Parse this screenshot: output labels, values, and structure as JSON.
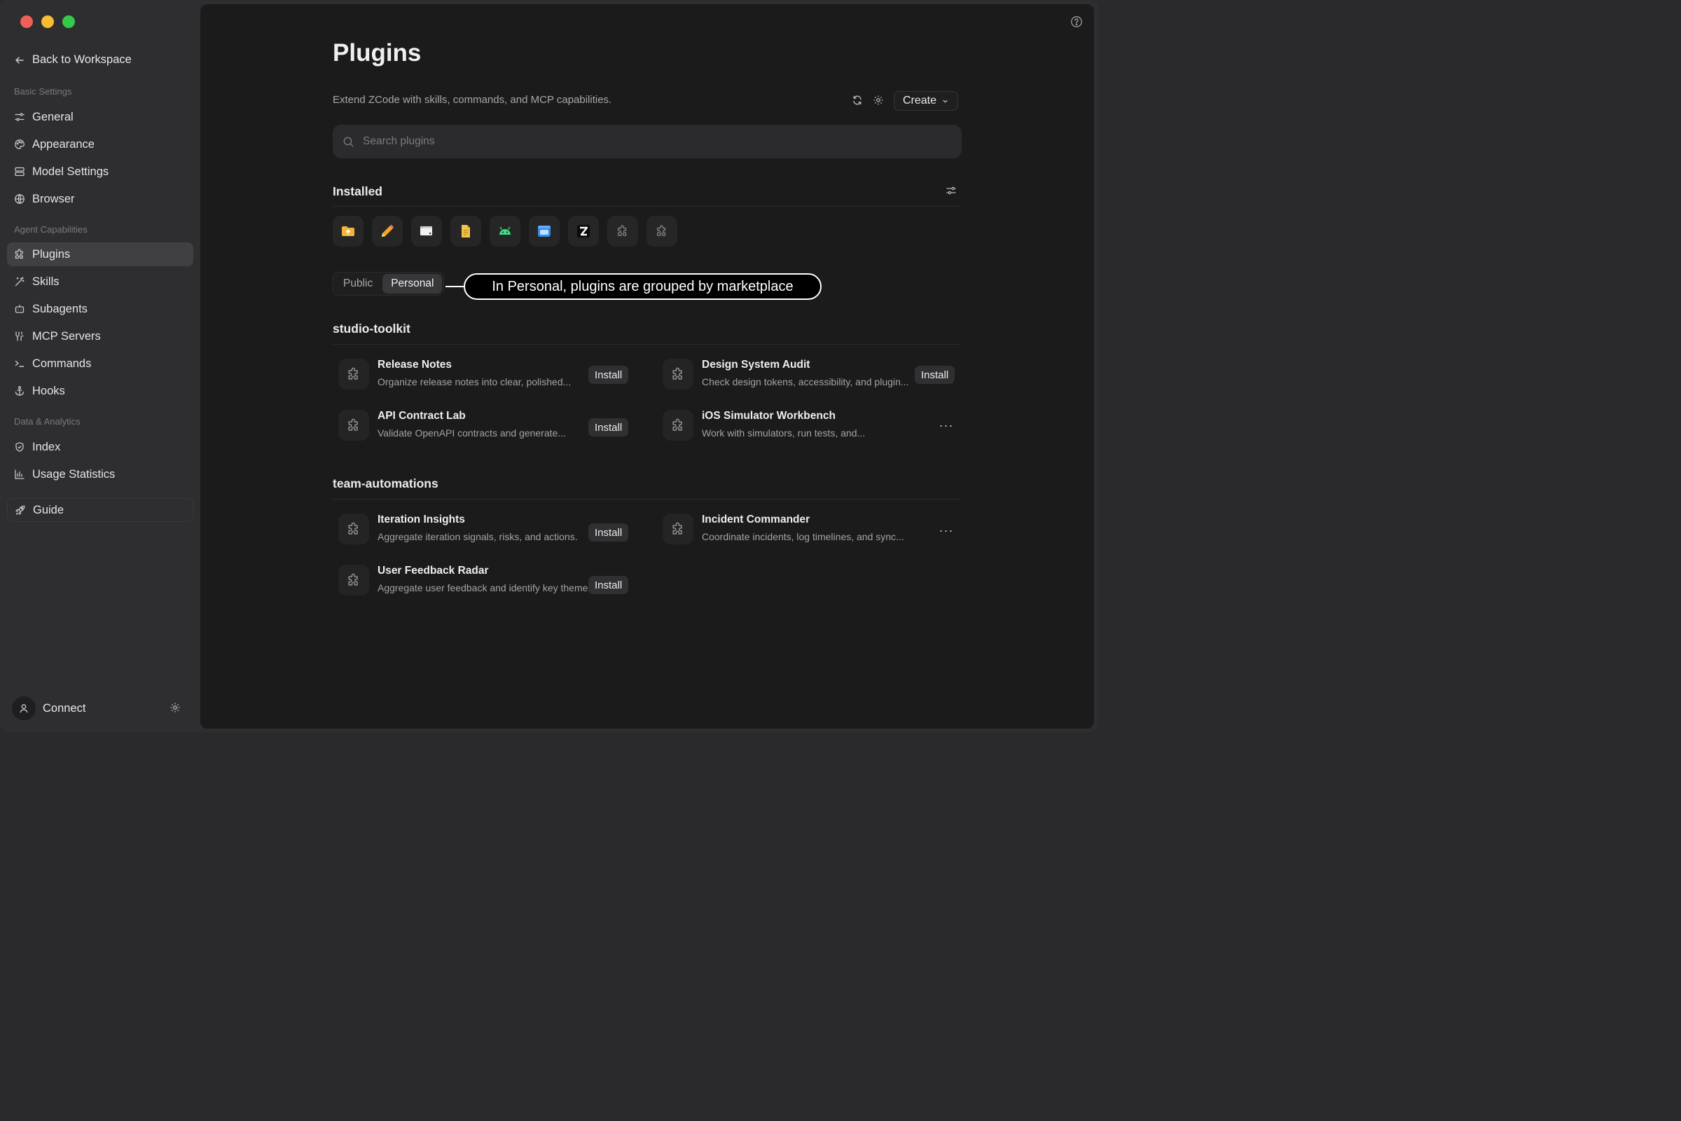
{
  "sidebar": {
    "back_label": "Back to Workspace",
    "sections": {
      "basic": "Basic Settings",
      "agent": "Agent Capabilities",
      "data": "Data & Analytics"
    },
    "items": {
      "general": "General",
      "appearance": "Appearance",
      "model_settings": "Model Settings",
      "browser": "Browser",
      "plugins": "Plugins",
      "skills": "Skills",
      "subagents": "Subagents",
      "mcp_servers": "MCP Servers",
      "commands": "Commands",
      "hooks": "Hooks",
      "index": "Index",
      "usage_statistics": "Usage Statistics",
      "guide": "Guide"
    },
    "connect_label": "Connect",
    "active_item": "plugins"
  },
  "main": {
    "title": "Plugins",
    "subtitle": "Extend ZCode with skills, commands, and MCP capabilities.",
    "create_label": "Create",
    "search_placeholder": "Search plugins",
    "installed_heading": "Installed",
    "installed_icons": [
      "upload-folder-icon",
      "pencil-icon",
      "window-cursor-icon",
      "document-icon",
      "android-icon",
      "finder-window-icon",
      "z-logo-icon",
      "puzzle-icon",
      "puzzle-icon"
    ],
    "tabs": {
      "public": "Public",
      "personal": "Personal",
      "active": "personal"
    },
    "callout": "In Personal, plugins are grouped by marketplace",
    "groups": [
      {
        "name": "studio-toolkit",
        "plugins": [
          {
            "name": "Release Notes",
            "description": "Organize release notes into clear, polished...",
            "action": "Install"
          },
          {
            "name": "Design System Audit",
            "description": "Check design tokens, accessibility, and plugin...",
            "action": "Install"
          },
          {
            "name": "API Contract Lab",
            "description": "Validate OpenAPI contracts and generate...",
            "action": "Install"
          },
          {
            "name": "iOS Simulator Workbench",
            "description": "Work with simulators, run tests, and...",
            "action": "···"
          }
        ]
      },
      {
        "name": "team-automations",
        "plugins": [
          {
            "name": "Iteration Insights",
            "description": "Aggregate iteration signals, risks, and actions.",
            "action": "Install"
          },
          {
            "name": "Incident Commander",
            "description": "Coordinate incidents, log timelines, and sync...",
            "action": "···"
          },
          {
            "name": "User Feedback Radar",
            "description": "Aggregate user feedback and identify key themes.",
            "action": "Install"
          }
        ]
      }
    ]
  },
  "colors": {
    "sidebar_bg": "#2e2e30",
    "main_bg": "#1b1b1b",
    "active_item_bg": "#404043",
    "traffic_red": "#ee5f57",
    "traffic_yellow": "#f5bd2f",
    "traffic_green": "#35c94a"
  }
}
